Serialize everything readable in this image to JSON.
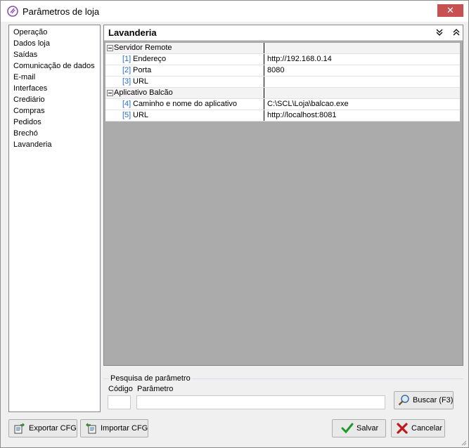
{
  "window": {
    "title": "Parâmetros de loja",
    "close_symbol": "✕",
    "accent_close": "#c75050",
    "icon": "app-logo-icon"
  },
  "sidebar": {
    "items": [
      {
        "label": "Operação"
      },
      {
        "label": "Dados loja"
      },
      {
        "label": "Saídas"
      },
      {
        "label": "Comunicação de dados"
      },
      {
        "label": "E-mail"
      },
      {
        "label": "Interfaces"
      },
      {
        "label": "Crediário"
      },
      {
        "label": "Compras"
      },
      {
        "label": "Pedidos"
      },
      {
        "label": "Brechó"
      },
      {
        "label": "Lavanderia"
      }
    ],
    "selected": "Lavanderia"
  },
  "section": {
    "title": "Lavanderia",
    "collapse_all_icon": "double-chevron-down-icon",
    "expand_all_icon": "double-chevron-up-icon"
  },
  "grid": {
    "groups": [
      {
        "label": "Servidor Remote",
        "params": [
          {
            "num": "[1]",
            "label": "Endereço",
            "value": "http://192.168.0.14"
          },
          {
            "num": "[2]",
            "label": "Porta",
            "value": "8080"
          },
          {
            "num": "[3]",
            "label": "URL",
            "value": ""
          }
        ]
      },
      {
        "label": "Aplicativo Balcão",
        "params": [
          {
            "num": "[4]",
            "label": "Caminho e nome do aplicativo",
            "value": "C:\\SCL\\Loja\\balcao.exe"
          },
          {
            "num": "[5]",
            "label": "URL",
            "value": "http://localhost:8081"
          }
        ]
      }
    ]
  },
  "search": {
    "legend": "Pesquisa de parâmetro",
    "code_label": "Código",
    "param_label": "Parâmetro",
    "code_value": "",
    "param_value": "",
    "search_button": "Buscar (F3)"
  },
  "footer": {
    "export_label": "Exportar CFG",
    "import_label": "Importar CFG",
    "save_label": "Salvar",
    "cancel_label": "Cancelar"
  }
}
